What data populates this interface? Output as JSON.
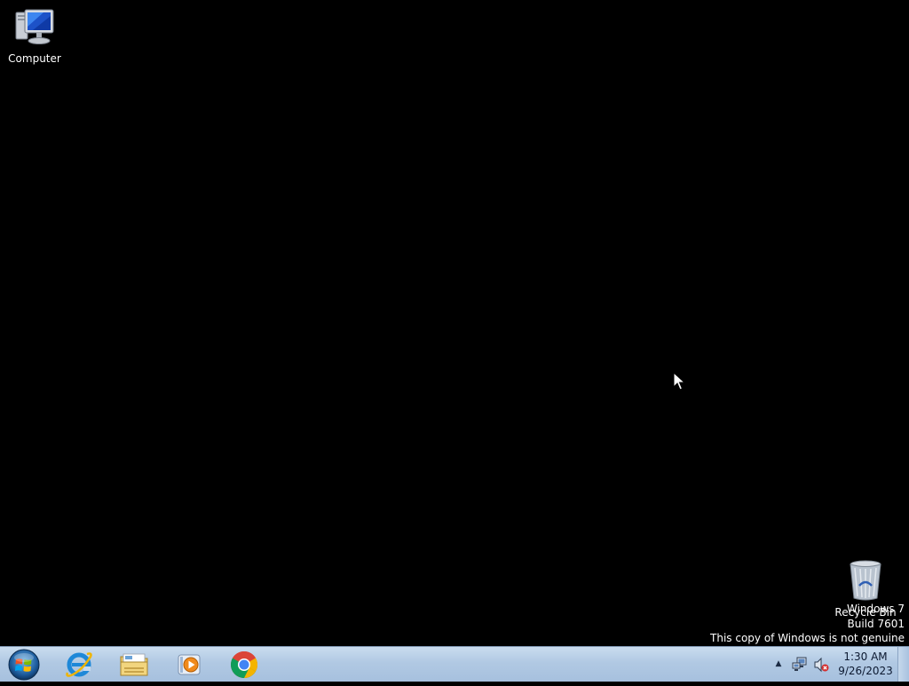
{
  "desktop": {
    "icons": [
      {
        "label": "Computer",
        "icon": "computer-icon"
      },
      {
        "label": "Recycle Bin",
        "icon": "recycle-bin-icon"
      }
    ]
  },
  "watermark": {
    "line1": "Windows 7",
    "line2": "Build 7601",
    "line3": "This copy of Windows is not genuine"
  },
  "taskbar": {
    "start_icon": "windows-logo-icon",
    "pinned": [
      {
        "name": "Internet Explorer",
        "icon": "internet-explorer-icon"
      },
      {
        "name": "Windows Explorer",
        "icon": "folder-explorer-icon"
      },
      {
        "name": "Windows Media Player",
        "icon": "media-player-icon"
      },
      {
        "name": "Google Chrome",
        "icon": "chrome-icon"
      }
    ],
    "tray": {
      "arrow": "▲",
      "network_icon": "network-icon",
      "volume_icon": "volume-muted-icon"
    },
    "clock": {
      "time": "1:30 AM",
      "date": "9/26/2023"
    }
  },
  "colors": {
    "desktop_background": "#000000",
    "taskbar_top": "#c9dcef",
    "taskbar_bottom": "#a6c0de"
  }
}
